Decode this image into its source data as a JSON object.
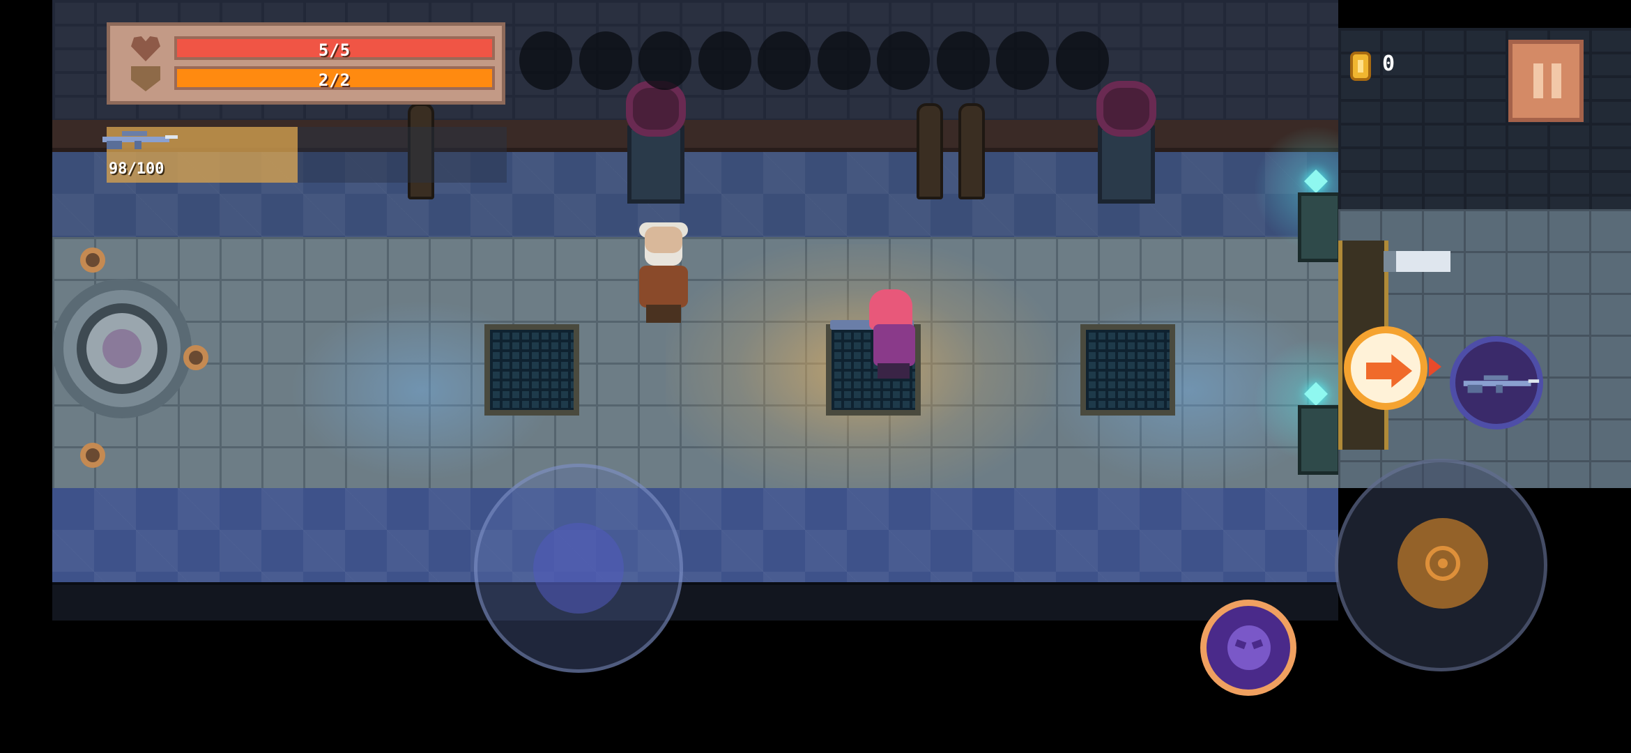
{
  "hud": {
    "hp_text": "5/5",
    "hp_fraction": 1.0,
    "armor_text": "2/2",
    "armor_fraction": 1.0,
    "energy_slot_count": 10,
    "weapon_ammo": "98/100",
    "coins": "0"
  },
  "icons": {
    "heart": "heart-icon",
    "shield": "shield-icon",
    "coin": "coin-icon",
    "pause": "pause-icon",
    "weapon": "sniper-rifle-icon",
    "skill": "skull-icon",
    "interact": "arrow-right-icon",
    "attack": "crosshair-icon"
  },
  "colors": {
    "hp_bar": "#f05545",
    "armor_bar": "#ff8a10",
    "hud_panel": "#c39a86",
    "coin": "#f0b630",
    "interact_ring": "#f5a330",
    "skill_ring": "#f0a060"
  }
}
